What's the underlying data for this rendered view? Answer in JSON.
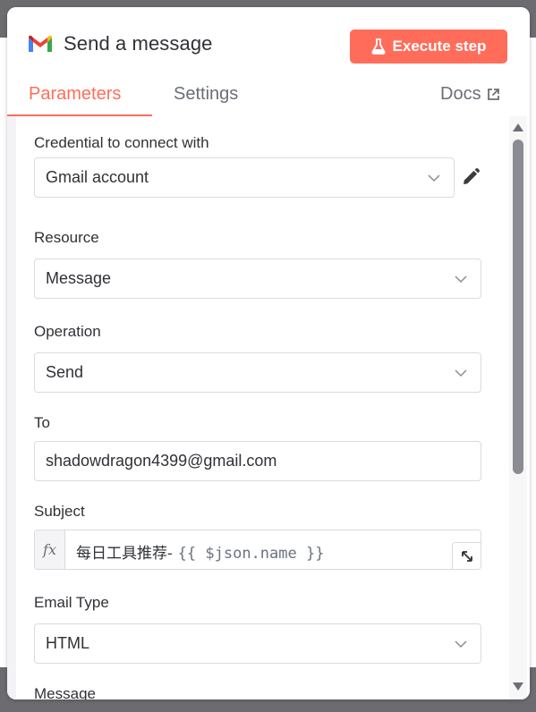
{
  "header": {
    "title": "Send a message",
    "execute_label": "Execute step"
  },
  "tabs": {
    "parameters": "Parameters",
    "settings": "Settings",
    "docs": "Docs"
  },
  "form": {
    "credential": {
      "label": "Credential to connect with",
      "value": "Gmail account"
    },
    "resource": {
      "label": "Resource",
      "value": "Message"
    },
    "operation": {
      "label": "Operation",
      "value": "Send"
    },
    "to": {
      "label": "To",
      "value": "shadowdragon4399@gmail.com"
    },
    "subject": {
      "label": "Subject",
      "fx": "fx",
      "prefix": "每日工具推荐-",
      "expression": "{{ $json.name }}"
    },
    "email_type": {
      "label": "Email Type",
      "value": "HTML"
    },
    "message": {
      "label": "Message"
    }
  },
  "icons": {
    "brand": "gmail-icon",
    "execute": "flask-icon",
    "docs": "external-link-icon",
    "edit": "pencil-icon",
    "dropdown": "chevron-down-icon",
    "expand": "expand-icon"
  },
  "colors": {
    "accent": "#ff6d5a",
    "text": "#2f3136",
    "muted": "#6b6f76",
    "border": "#d9dbe0"
  }
}
